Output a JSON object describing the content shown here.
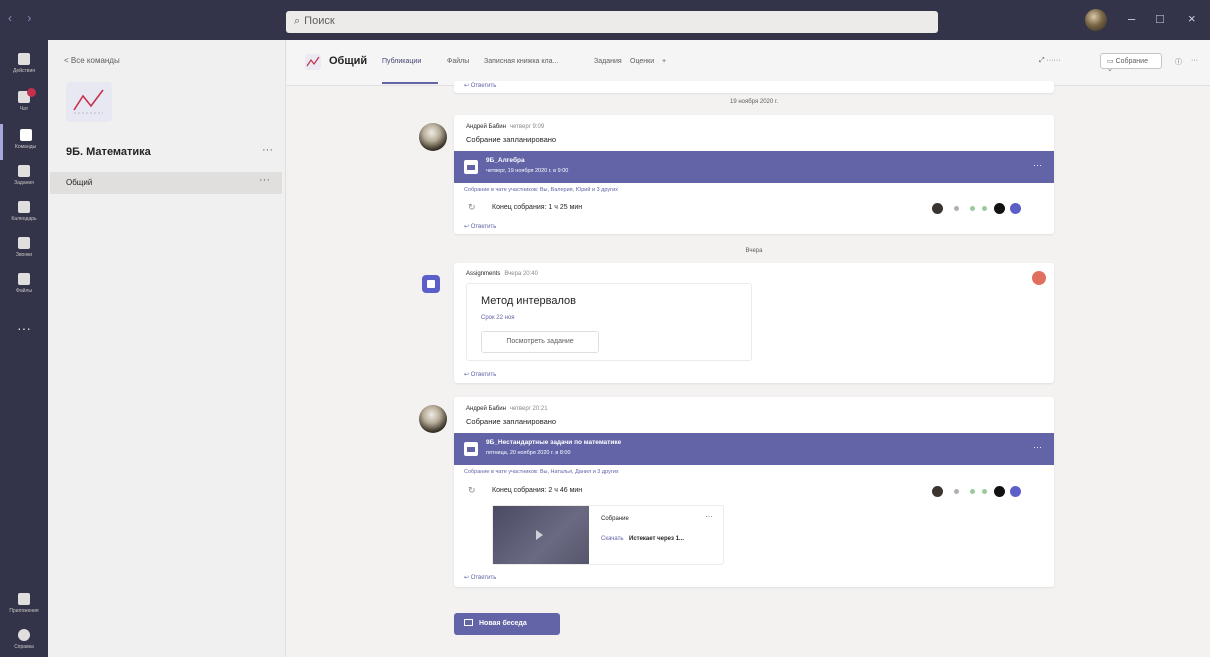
{
  "window": {
    "search_placeholder": "Поиск"
  },
  "rail": {
    "items": [
      {
        "label": "Действия",
        "icon": "bell-icon"
      },
      {
        "label": "Чат",
        "icon": "chat-icon"
      },
      {
        "label": "Команды",
        "icon": "teams-icon"
      },
      {
        "label": "Задания",
        "icon": "assignments-icon"
      },
      {
        "label": "Календарь",
        "icon": "calendar-icon"
      },
      {
        "label": "Звонки",
        "icon": "phone-icon"
      },
      {
        "label": "Файлы",
        "icon": "file-icon"
      }
    ],
    "more": "···",
    "bottom": [
      {
        "label": "Приложения",
        "icon": "apps-icon"
      },
      {
        "label": "Справка",
        "icon": "help-icon"
      }
    ]
  },
  "team": {
    "back_label": "< Все команды",
    "name": "9Б. Математика",
    "more": "···",
    "channel": "Общий",
    "channel_more": "···"
  },
  "header": {
    "channel_title": "Общий",
    "tabs": [
      "Публикации",
      "Файлы",
      "Записная книжка кла...",
      "Задания",
      "Оценки",
      "+"
    ],
    "meet_label": "Собрание",
    "right_more": "···"
  },
  "feed": {
    "top_reply": "Ответить",
    "date_1": "19 ноября 2020 г.",
    "post_1": {
      "author": "Андрей Бабин",
      "time": "четверг 9:09",
      "subtitle": "Собрание запланировано",
      "meeting_title": "9Б_Алгебра",
      "meeting_time": "четверг, 19 ноября 2020 г. в 9:00",
      "joined": "Собрание в чате участников: Вы, Валерия, Юрий и 3 других",
      "ended": "Конец собрания: 1 ч 25 мин",
      "reply": "Ответить"
    },
    "date_2": "Вчера",
    "post_2": {
      "author": "Assignments",
      "time": "Вчера 20:40",
      "title": "Метод интервалов",
      "due": "Срок 22 ноя",
      "button": "Посмотреть задание",
      "reply": "Ответить"
    },
    "post_3": {
      "author": "Андрей Бабин",
      "time": "четверг 20:21",
      "subtitle": "Собрание запланировано",
      "meeting_title": "9Б_Нестандартные задачи по математике",
      "meeting_time": "пятница, 20 ноября 2020 г. в 8:00",
      "joined": "Собрание в чате участников: Вы, Наталья, Данил и 3 других",
      "ended": "Конец собрания: 2 ч 46 мин",
      "rec_name": "Собрание",
      "rec_link": "Скачать",
      "rec_expiry": "Истекает через 1...",
      "reply": "Ответить"
    },
    "new_conversation": "Новая беседа"
  },
  "colors": {
    "accent": "#6264a7",
    "titlebar": "#33344a"
  }
}
